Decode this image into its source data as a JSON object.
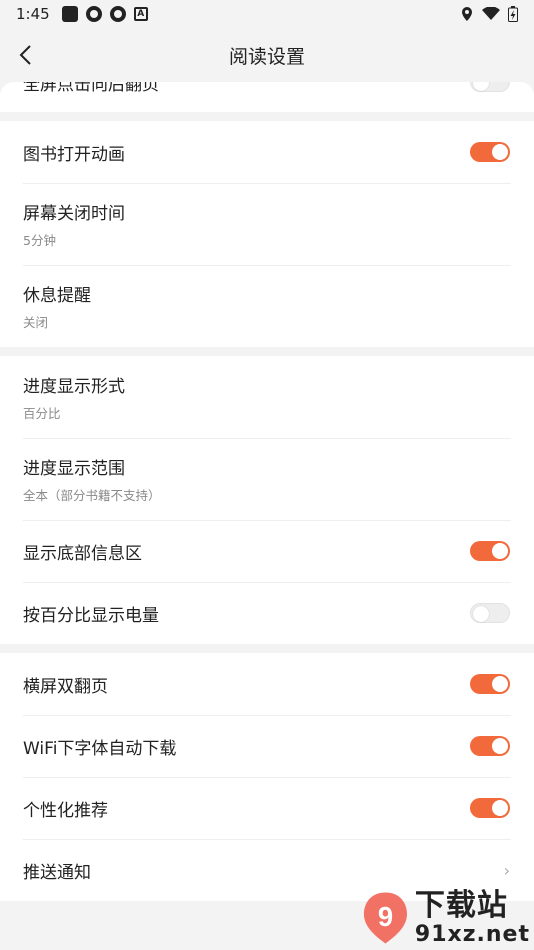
{
  "status": {
    "time": "1:45"
  },
  "header": {
    "title": "阅读设置"
  },
  "partial_row": {
    "title": "全屏点击向后翻页"
  },
  "group1": [
    {
      "title": "图书打开动画",
      "toggle": "on"
    },
    {
      "title": "屏幕关闭时间",
      "sub": "5分钟"
    },
    {
      "title": "休息提醒",
      "sub": "关闭"
    }
  ],
  "group2": [
    {
      "title": "进度显示形式",
      "sub": "百分比"
    },
    {
      "title": "进度显示范围",
      "sub": "全本（部分书籍不支持）"
    },
    {
      "title": "显示底部信息区",
      "toggle": "on"
    },
    {
      "title": "按百分比显示电量",
      "toggle": "off"
    }
  ],
  "group3": [
    {
      "title": "横屏双翻页",
      "toggle": "on"
    },
    {
      "title": "WiFi下字体自动下载",
      "toggle": "on"
    },
    {
      "title": "个性化推荐",
      "toggle": "on"
    },
    {
      "title": "推送通知",
      "chevron": "›"
    }
  ],
  "watermark": {
    "cn": "下载站",
    "url": "91xz.net",
    "logo_text": "9"
  },
  "colors": {
    "accent": "#f26a3c",
    "background": "#f3f3f3"
  }
}
